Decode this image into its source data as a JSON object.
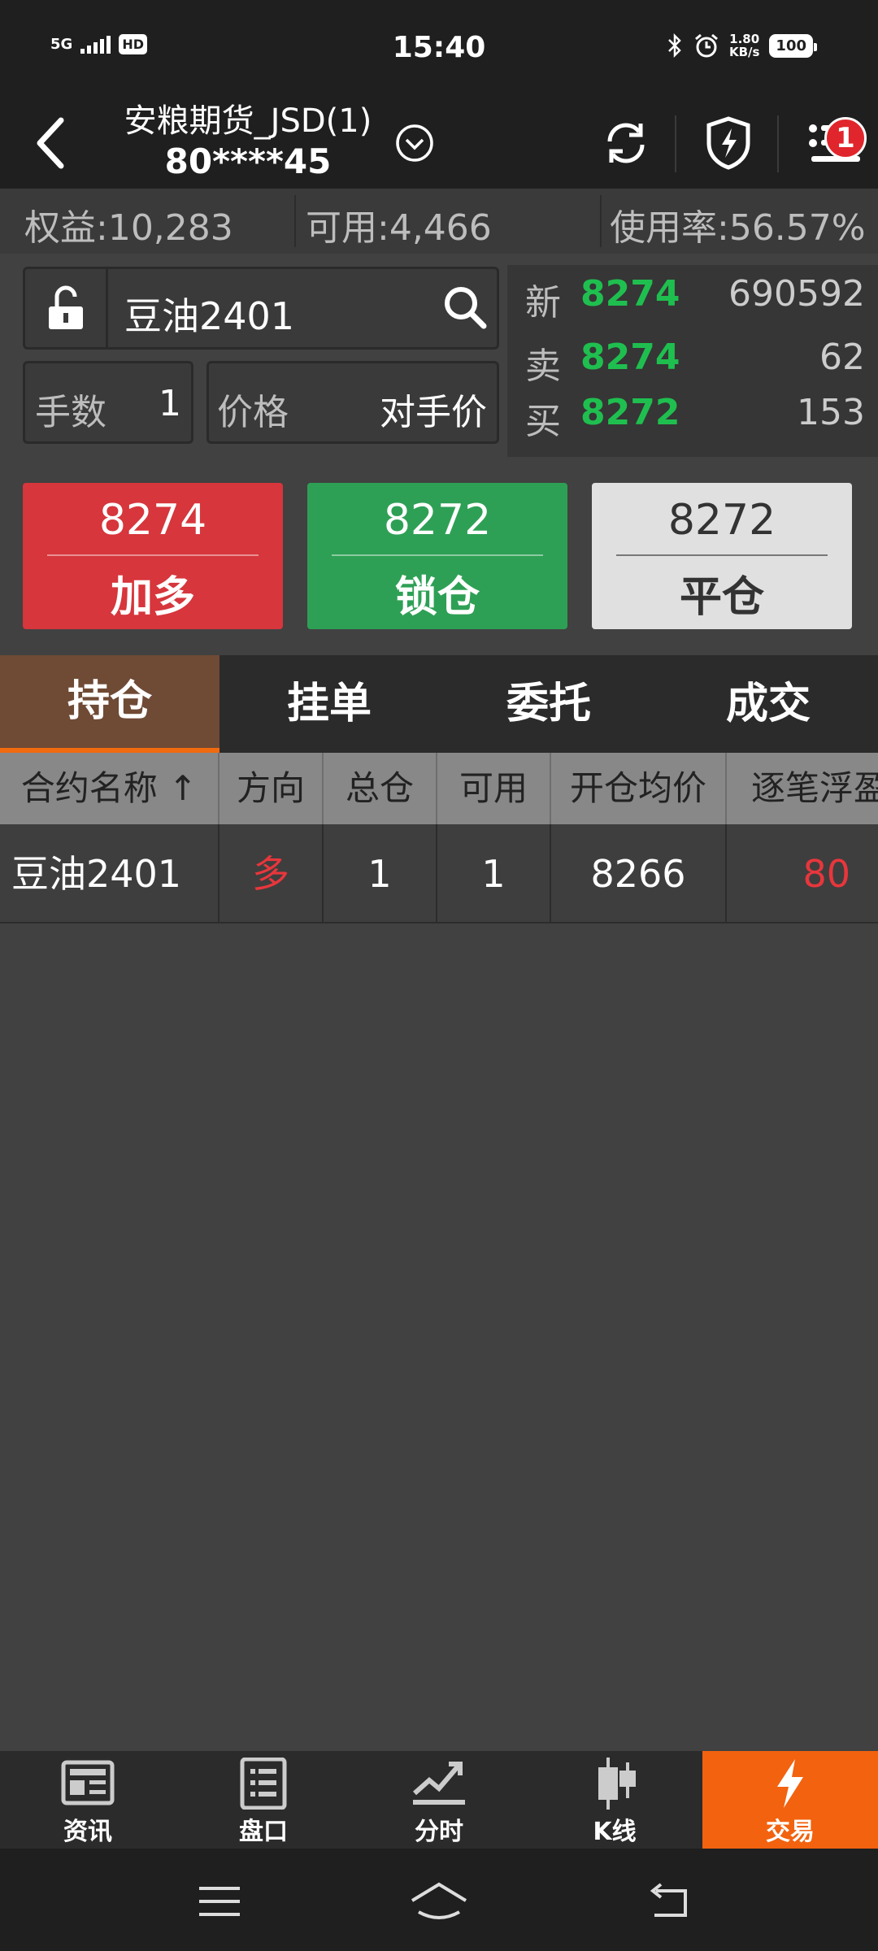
{
  "status_bar": {
    "network": "5G",
    "hd": "HD",
    "time": "15:40",
    "speed_value": "1.80",
    "speed_unit": "KB/s",
    "battery": "100"
  },
  "header": {
    "account_name": "安粮期货_JSD(1)",
    "account_no": "80****45",
    "notification_count": "1"
  },
  "equity": {
    "equity": "权益:10,283",
    "available": "可用:4,466",
    "usage": "使用率:56.57%"
  },
  "order": {
    "contract": "豆油2401",
    "qty_label": "手数",
    "qty_value": "1",
    "price_label": "价格",
    "price_value": "对手价"
  },
  "quote": {
    "rows": [
      {
        "key": "新",
        "price": "8274",
        "vol": "690592"
      },
      {
        "key": "卖",
        "price": "8274",
        "vol": "62"
      },
      {
        "key": "买",
        "price": "8272",
        "vol": "153"
      }
    ]
  },
  "buttons": {
    "buy": {
      "price": "8274",
      "label": "加多"
    },
    "lock": {
      "price": "8272",
      "label": "锁仓"
    },
    "close": {
      "price": "8272",
      "label": "平仓"
    }
  },
  "tabs": [
    "持仓",
    "挂单",
    "委托",
    "成交"
  ],
  "table": {
    "headers": [
      "合约名称 ↑",
      "方向",
      "总仓",
      "可用",
      "开仓均价",
      "逐笔浮盈"
    ],
    "rows": [
      {
        "name": "豆油2401",
        "dir": "多",
        "total": "1",
        "avail": "1",
        "avg": "8266",
        "pnl": "80"
      }
    ]
  },
  "bottom_nav": [
    "资讯",
    "盘口",
    "分时",
    "K线",
    "交易"
  ],
  "colors": {
    "up": "#e8363c",
    "down_green": "#1fbf4f",
    "accent": "#f2620f"
  }
}
